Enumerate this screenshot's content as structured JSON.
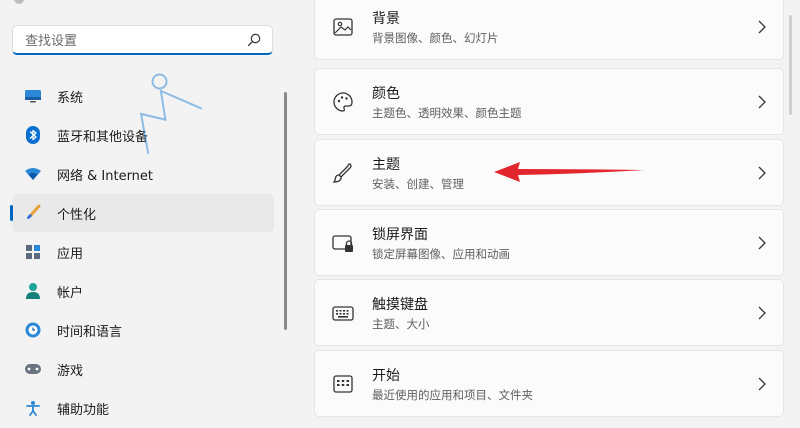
{
  "search": {
    "placeholder": "查找设置"
  },
  "nav": {
    "items": [
      {
        "label": "系统",
        "icon": "monitor-icon"
      },
      {
        "label": "蓝牙和其他设备",
        "icon": "bluetooth-icon"
      },
      {
        "label": "网络 & Internet",
        "icon": "wifi-icon"
      },
      {
        "label": "个性化",
        "icon": "brush-icon",
        "active": true
      },
      {
        "label": "应用",
        "icon": "apps-icon"
      },
      {
        "label": "帐户",
        "icon": "account-icon"
      },
      {
        "label": "时间和语言",
        "icon": "clock-globe-icon"
      },
      {
        "label": "游戏",
        "icon": "gamepad-icon"
      },
      {
        "label": "辅助功能",
        "icon": "accessibility-icon"
      }
    ]
  },
  "cards": [
    {
      "title": "背景",
      "desc": "背景图像、颜色、幻灯片",
      "icon": "image-icon"
    },
    {
      "title": "颜色",
      "desc": "主题色、透明效果、颜色主题",
      "icon": "palette-icon"
    },
    {
      "title": "主题",
      "desc": "安装、创建、管理",
      "icon": "brush-icon"
    },
    {
      "title": "锁屏界面",
      "desc": "锁定屏幕图像、应用和动画",
      "icon": "lock-screen-icon"
    },
    {
      "title": "触摸键盘",
      "desc": "主题、大小",
      "icon": "keyboard-icon"
    },
    {
      "title": "开始",
      "desc": "最近使用的应用和项目、文件夹",
      "icon": "start-menu-icon"
    }
  ],
  "colors": {
    "accent": "#0067c0",
    "annotation_arrow": "#e3262d"
  }
}
